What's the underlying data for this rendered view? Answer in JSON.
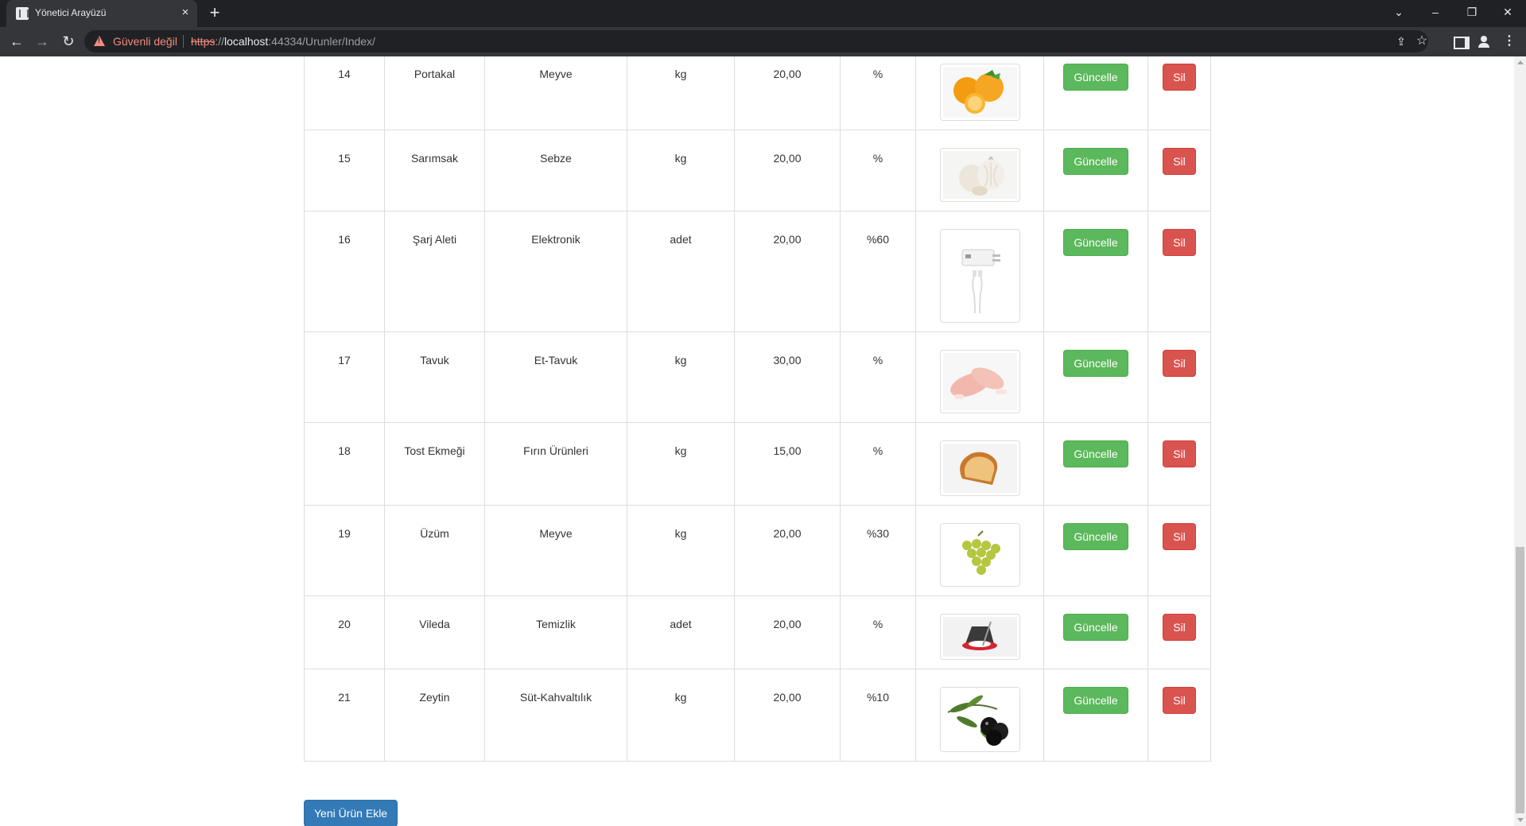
{
  "browser": {
    "tab_title": "Yönetici Arayüzü",
    "tab_close": "×",
    "new_tab": "+",
    "security_label": "Güvenli değil",
    "url_scheme": "https",
    "url_sep": "://",
    "url_host": "localhost",
    "url_rest": ":44334/Urunler/Index/"
  },
  "products": [
    {
      "id": "14",
      "name": "Portakal",
      "category": "Meyve",
      "unit": "kg",
      "price": "20,00",
      "discount": "%",
      "image": "orange"
    },
    {
      "id": "15",
      "name": "Sarımsak",
      "category": "Sebze",
      "unit": "kg",
      "price": "20,00",
      "discount": "%",
      "image": "garlic"
    },
    {
      "id": "16",
      "name": "Şarj Aleti",
      "category": "Elektronik",
      "unit": "adet",
      "price": "20,00",
      "discount": "%60",
      "image": "charger"
    },
    {
      "id": "17",
      "name": "Tavuk",
      "category": "Et-Tavuk",
      "unit": "kg",
      "price": "30,00",
      "discount": "%",
      "image": "chicken"
    },
    {
      "id": "18",
      "name": "Tost Ekmeği",
      "category": "Fırın Ürünleri",
      "unit": "kg",
      "price": "15,00",
      "discount": "%",
      "image": "toast"
    },
    {
      "id": "19",
      "name": "Üzüm",
      "category": "Meyve",
      "unit": "kg",
      "price": "20,00",
      "discount": "%30",
      "image": "grapes"
    },
    {
      "id": "20",
      "name": "Vileda",
      "category": "Temizlik",
      "unit": "adet",
      "price": "20,00",
      "discount": "%",
      "image": "mop"
    },
    {
      "id": "21",
      "name": "Zeytin",
      "category": "Süt-Kahvaltılık",
      "unit": "kg",
      "price": "20,00",
      "discount": "%10",
      "image": "olive"
    }
  ],
  "actions": {
    "update_label": "Güncelle",
    "delete_label": "Sil",
    "add_label": "Yeni Ürün Ekle"
  },
  "colors": {
    "update": "#5cb85c",
    "delete": "#d9534f",
    "primary": "#337ab7",
    "insecure": "#f28b82"
  }
}
